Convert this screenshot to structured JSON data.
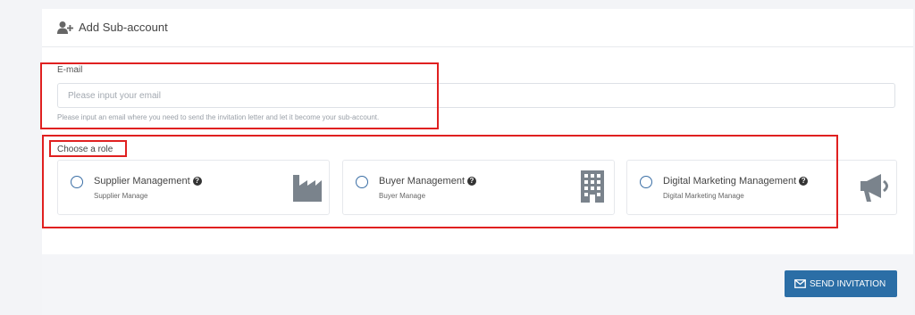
{
  "header": {
    "title": "Add Sub-account",
    "icon": "add-user-icon"
  },
  "email": {
    "label": "E-mail",
    "placeholder": "Please input your email",
    "value": "",
    "help": "Please input an email where you need to send the invitation letter and let it become your sub-account."
  },
  "roles": {
    "label": "Choose a role",
    "items": [
      {
        "title": "Supplier Management",
        "subtitle": "Supplier Manage",
        "icon": "factory-icon",
        "selected": false
      },
      {
        "title": "Buyer Management",
        "subtitle": "Buyer Manage",
        "icon": "building-icon",
        "selected": false
      },
      {
        "title": "Digital Marketing Management",
        "subtitle": "Digital Marketing Manage",
        "icon": "megaphone-icon",
        "selected": false
      }
    ]
  },
  "footer": {
    "send_label": "SEND INVITATION",
    "send_icon": "envelope-icon"
  },
  "colors": {
    "accent": "#2b6ea6",
    "highlight": "#e02020",
    "icon_gray": "#7a838c"
  }
}
